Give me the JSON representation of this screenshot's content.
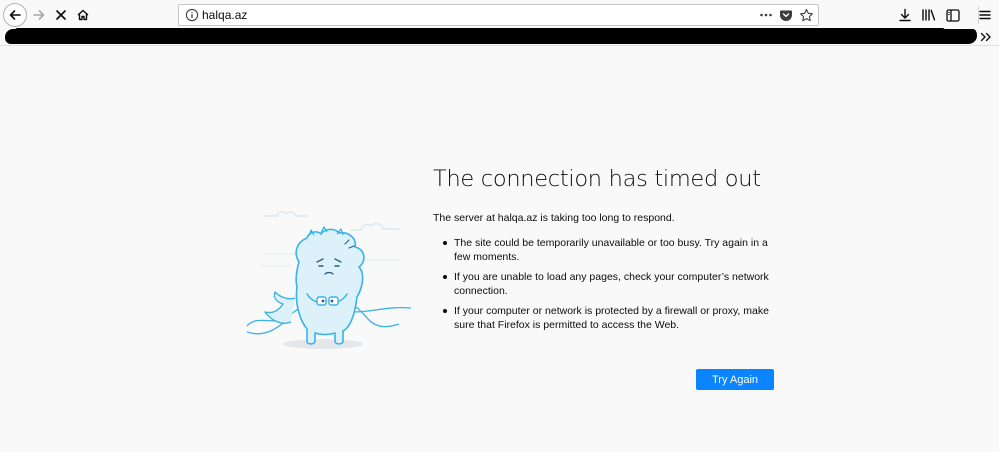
{
  "browser": {
    "url": "halqa.az",
    "icons": {
      "back": "arrow-left-icon",
      "forward": "arrow-right-icon",
      "stop": "close-x-icon",
      "home": "home-icon",
      "site_info": "info-circle-icon",
      "page_actions": "more-dots-icon",
      "pocket": "pocket-icon",
      "bookmark": "star-icon",
      "downloads": "download-arrow-icon",
      "library": "library-icon",
      "sidebar": "sidebar-icon",
      "menu": "hamburger-icon",
      "overflow": "double-chevron-icon"
    }
  },
  "error_page": {
    "title": "The connection has timed out",
    "description": "The server at halqa.az is taking too long to respond.",
    "reasons": [
      "The site could be temporarily unavailable or too busy. Try again in a few moments.",
      "If you are unable to load any pages, check your computer’s network connection.",
      "If your computer or network is protected by a firewall or proxy, make sure that Firefox is permitted to access the Web."
    ],
    "try_again_label": "Try Again"
  },
  "colors": {
    "accent": "#0a84ff",
    "page_bg": "#f9f9fa",
    "illustration_stroke": "#39b3e6",
    "illustration_fill": "#ddf1fb"
  }
}
